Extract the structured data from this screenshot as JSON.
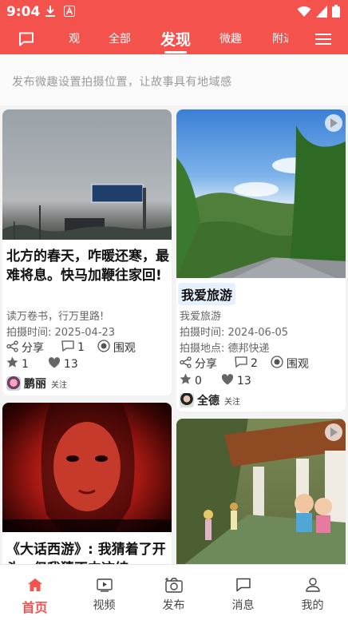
{
  "status": {
    "time": "9:04"
  },
  "nav": {
    "tabs": [
      "观",
      "全部",
      "发现",
      "微趣",
      "附近"
    ],
    "active": "发现"
  },
  "hint": "发布微趣设置拍摄位置，让故事具有地域感",
  "cards": [
    {
      "title": "北方的春天，咋暖还寒，最难将息。快马加鞭往家回!",
      "subtitle": "读万卷书，行万里路!",
      "shot_time": "拍摄时间: 2025-04-23",
      "share": "分享",
      "comments": "1",
      "watch": "围观",
      "stars": "1",
      "likes": "13",
      "author": "鹏丽",
      "follow": "关注"
    },
    {
      "title": "我爱旅游",
      "subtitle": "我爱旅游",
      "shot_time": "拍摄时间: 2024-06-05",
      "location": "拍摄地点: 德邦快递",
      "share": "分享",
      "comments": "2",
      "watch": "围观",
      "stars": "0",
      "likes": "13",
      "author": "全德",
      "follow": "关注"
    },
    {
      "title": "《大话西游》: 我猜着了开头，但我猜不中这结"
    }
  ],
  "bottom_nav": [
    {
      "label": "首页",
      "icon": "home-icon",
      "active": true
    },
    {
      "label": "视频",
      "icon": "video-icon",
      "active": false
    },
    {
      "label": "发布",
      "icon": "camera-icon",
      "active": false
    },
    {
      "label": "消息",
      "icon": "message-icon",
      "active": false
    },
    {
      "label": "我的",
      "icon": "user-icon",
      "active": false
    }
  ],
  "colors": {
    "brand": "#f4524d",
    "highlight": "#e6f1ff"
  }
}
